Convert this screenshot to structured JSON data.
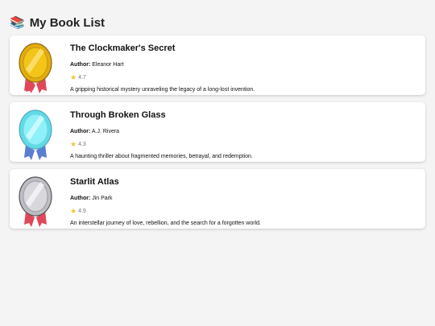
{
  "page": {
    "title": "My Book List",
    "title_icon": "books-icon"
  },
  "labels": {
    "author_prefix": "Author:"
  },
  "books": [
    {
      "title": "The Clockmaker's Secret",
      "author": "Eleanor Hart",
      "rating": "4.7",
      "description": "A gripping historical mystery unraveling the legacy of a long-lost invention.",
      "medal": "gold-medal-icon",
      "medal_color": "#f2c518",
      "ribbon_color": "#e0485a"
    },
    {
      "title": "Through Broken Glass",
      "author": "A.J. Rivera",
      "rating": "4.3",
      "description": "A haunting thriller about fragmented memories, betrayal, and redemption.",
      "medal": "diamond-medal-icon",
      "medal_color": "#7fe9f5",
      "ribbon_color": "#5b7fd0"
    },
    {
      "title": "Starlit Atlas",
      "author": "Jin Park",
      "rating": "4.9",
      "description": "An interstellar journey of love, rebellion, and the search for a forgotten world.",
      "medal": "silver-medal-icon",
      "medal_color": "#d4d4d8",
      "ribbon_color": "#e0485a"
    }
  ]
}
